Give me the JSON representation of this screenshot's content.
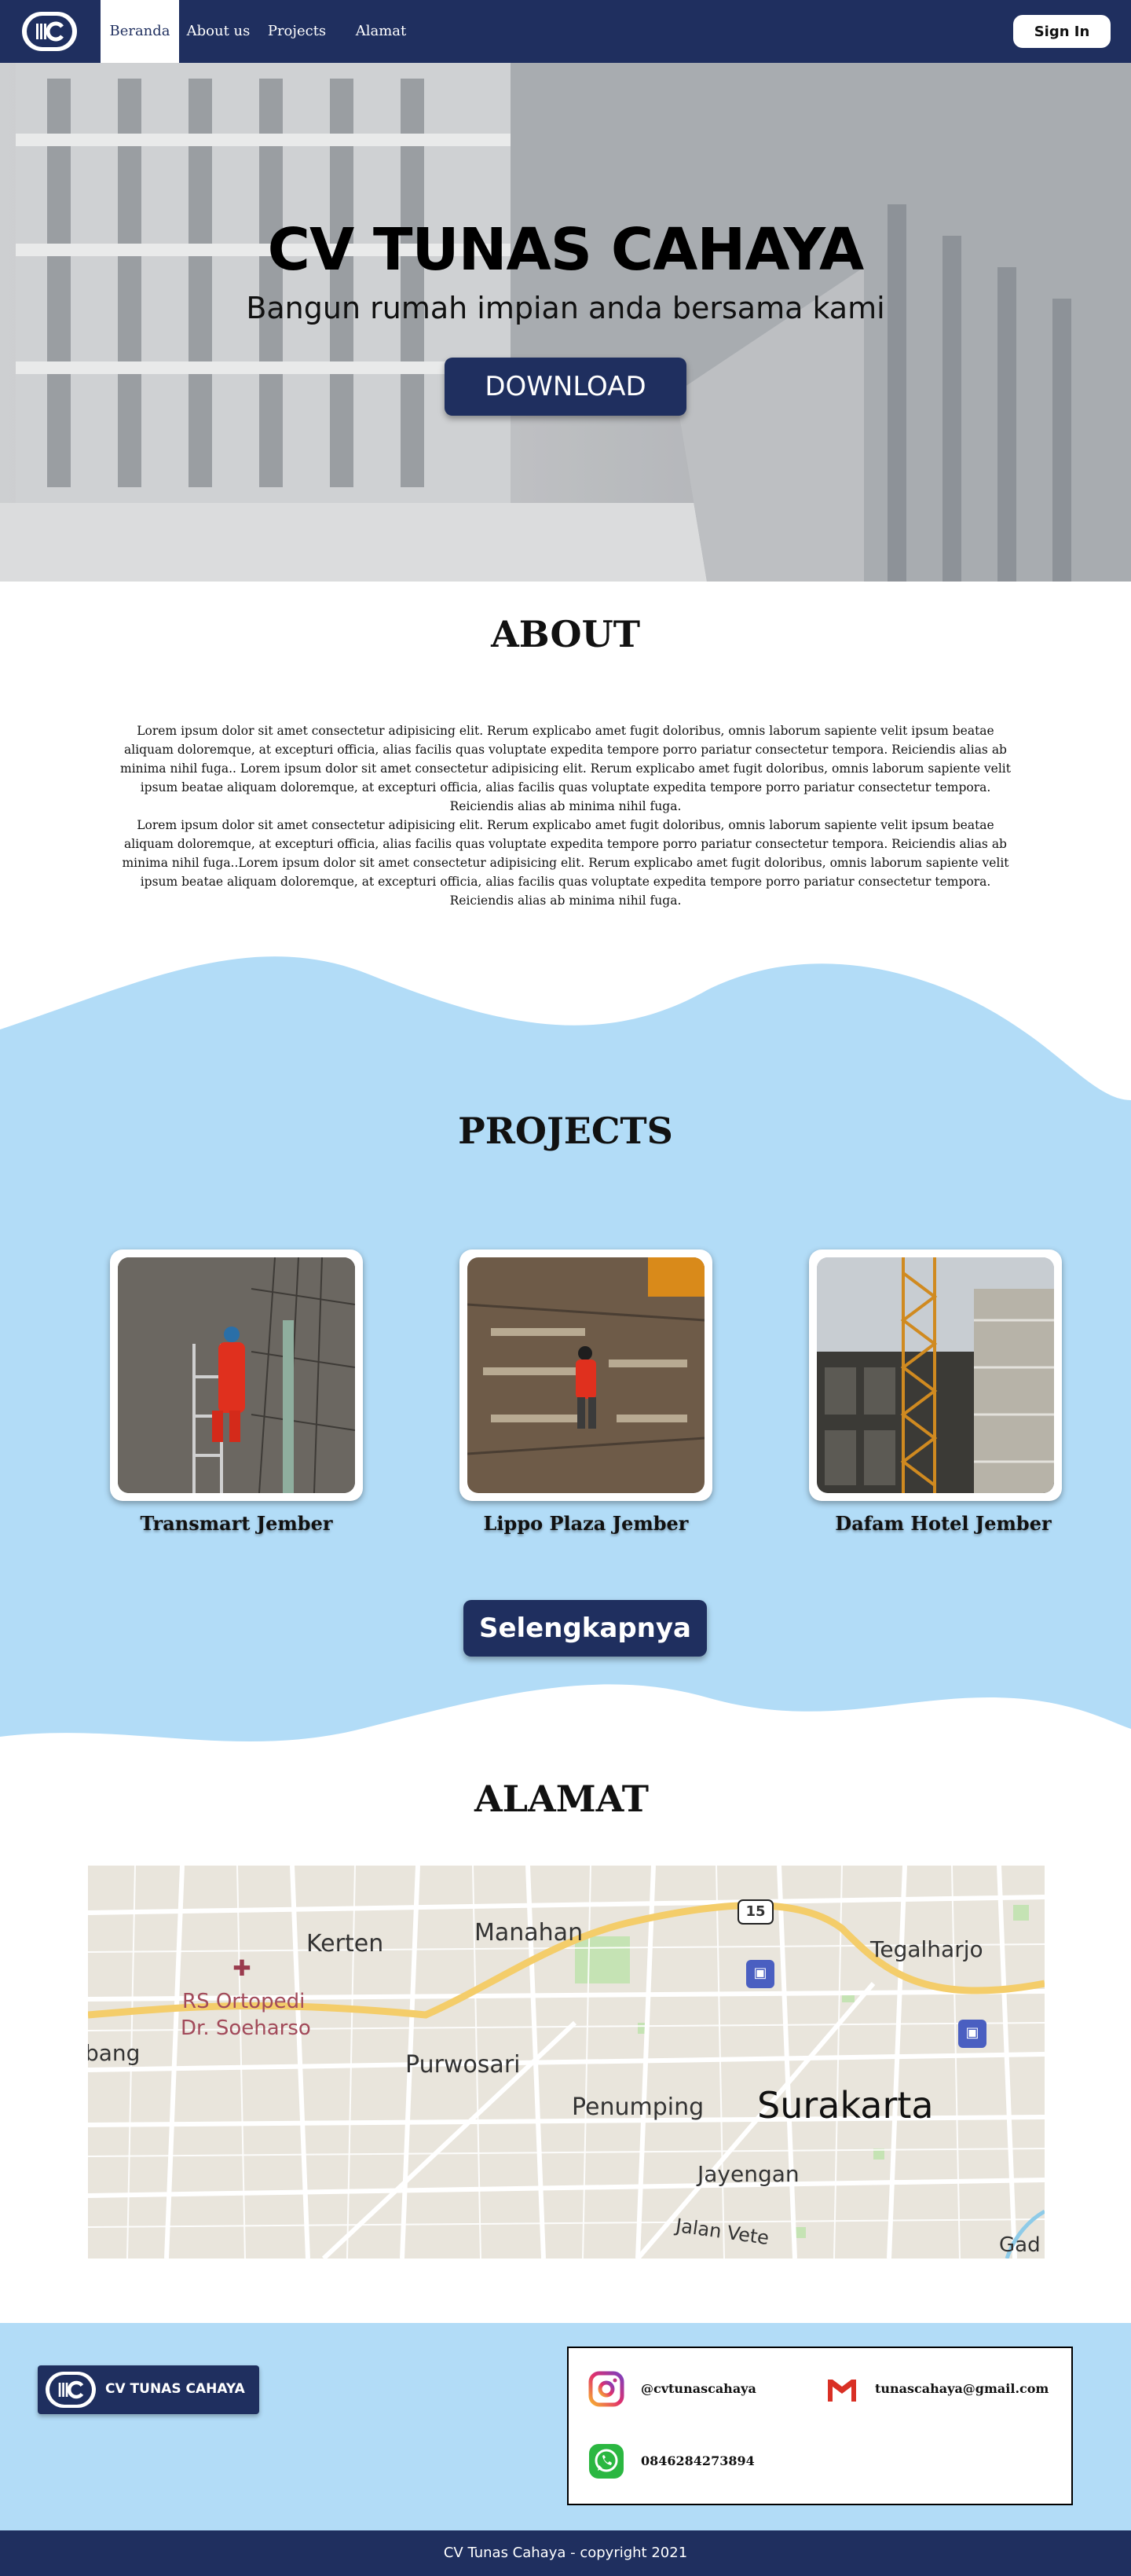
{
  "nav": {
    "logo_icon": "tc-logo-icon",
    "items": [
      {
        "label": "Beranda",
        "active": true
      },
      {
        "label": "About us",
        "active": false
      },
      {
        "label": "Projects",
        "active": false
      },
      {
        "label": "Alamat",
        "active": false
      }
    ],
    "signin_label": "Sign In"
  },
  "hero": {
    "title": "CV TUNAS CAHAYA",
    "subtitle": "Bangun rumah impian anda bersama kami",
    "download_label": "DOWNLOAD"
  },
  "about": {
    "title": "ABOUT",
    "paragraph_1": "Lorem ipsum dolor sit amet consectetur adipisicing elit. Rerum explicabo amet fugit doloribus, omnis laborum sapiente velit ipsum beatae aliquam doloremque, at excepturi officia, alias facilis quas voluptate expedita tempore porro pariatur consectetur tempora. Reiciendis alias ab minima nihil fuga.. Lorem ipsum dolor sit amet consectetur adipisicing elit. Rerum explicabo amet fugit doloribus, omnis laborum sapiente velit ipsum beatae aliquam doloremque, at excepturi officia, alias facilis quas voluptate expedita tempore porro pariatur consectetur tempora. Reiciendis alias ab minima nihil fuga.",
    "paragraph_2": "Lorem ipsum dolor sit amet consectetur adipisicing elit. Rerum explicabo amet fugit doloribus, omnis laborum sapiente velit ipsum beatae aliquam doloremque, at excepturi officia, alias facilis quas voluptate expedita tempore porro pariatur consectetur tempora. Reiciendis alias ab minima nihil fuga..Lorem ipsum dolor sit amet consectetur adipisicing elit. Rerum explicabo amet fugit doloribus, omnis laborum sapiente velit ipsum beatae aliquam doloremque, at excepturi officia, alias facilis quas voluptate expedita tempore porro pariatur consectetur tempora. Reiciendis alias ab minima nihil fuga."
  },
  "projects": {
    "title": "PROJECTS",
    "items": [
      {
        "name": "Transmart Jember"
      },
      {
        "name": "Lippo Plaza Jember"
      },
      {
        "name": "Dafam Hotel Jember"
      }
    ],
    "more_label": "Selengkapnya"
  },
  "alamat": {
    "title": "ALAMAT",
    "map_labels": {
      "kerten": "Kerten",
      "manahan": "Manahan",
      "tegalharjo": "Tegalharjo",
      "rs": "RS Ortopedi",
      "rs2": "Dr. Soeharso",
      "bang": "bang",
      "purwosari": "Purwosari",
      "penumping": "Penumping",
      "surakarta": "Surakarta",
      "jayengan": "Jayengan",
      "jalan": "Jalan Vete",
      "gad": "Gad",
      "route": "15"
    }
  },
  "footer": {
    "brand": "CV TUNAS CAHAYA",
    "instagram": "@cvtunascahaya",
    "email": "tunascahaya@gmail.com",
    "phone": "0846284273894",
    "copyright": "CV Tunas Cahaya - copyright 2021"
  },
  "colors": {
    "navy": "#1f2f5f",
    "light_blue": "#b2dcf7"
  }
}
